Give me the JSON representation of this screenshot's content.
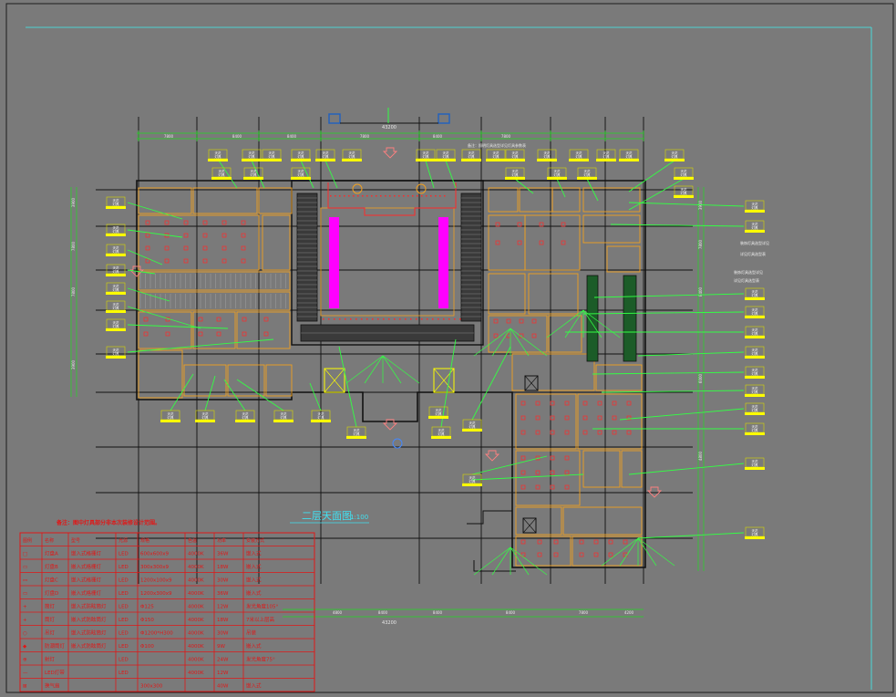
{
  "colors": {
    "background": "#7a7a7a",
    "frame": "#3ff0f0",
    "wall": "#111111",
    "partition": "#f0a020",
    "dimension": "#22dd22",
    "leader": "#33ff44",
    "tag_box": "#ffff00",
    "legend": "#e01818",
    "magenta": "#ff00ff",
    "stair": "#2a2a2a",
    "green_block": "#1c5c28",
    "light_red": "#ff2a2a",
    "cyan_text": "#40e0f0"
  },
  "plan": {
    "title": "二层天面图",
    "scale": "1:100",
    "overall_dim_top": "43200",
    "overall_dim_bottom": "43200",
    "note_top": "备注：照明灯具选型详见灯具参数表"
  },
  "legend": {
    "note": "备注：图中灯具部分非本次装修设计范围。",
    "headers": [
      "图例",
      "名称",
      "型号",
      "光源",
      "规格",
      "色温",
      "功率",
      "安装方式"
    ],
    "rows": [
      [
        "□",
        "灯盘A",
        "嵌入式格栅灯",
        "LED",
        "600x600x9",
        "4000K",
        "36W",
        "嵌入式"
      ],
      [
        "▭",
        "灯盘B",
        "嵌入式格栅灯",
        "LED",
        "300x300x9",
        "4000K",
        "18W",
        "嵌入式"
      ],
      [
        "▭",
        "灯盘C",
        "嵌入式格栅灯",
        "LED",
        "1200x100x9",
        "4000K",
        "30W",
        "嵌入式"
      ],
      [
        "▭",
        "灯盘D",
        "嵌入式格栅灯",
        "LED",
        "1200x300x9",
        "4000K",
        "36W",
        "嵌入式"
      ],
      [
        "+",
        "筒灯",
        "嵌入式防眩筒灯",
        "LED",
        "Φ125",
        "4000K",
        "12W",
        "发光角度105°"
      ],
      [
        "+",
        "筒灯",
        "嵌入式防眩筒灯",
        "LED",
        "Φ150",
        "4000K",
        "18W",
        "7米以上层高"
      ],
      [
        "○",
        "吊灯",
        "嵌入式防眩筒灯",
        "LED",
        "Φ1200*H300",
        "4000K",
        "30W",
        "吊装"
      ],
      [
        "◆",
        "防潮筒灯",
        "嵌入式防眩筒灯",
        "LED",
        "Φ100",
        "4000K",
        "9W",
        "嵌入式"
      ],
      [
        "⊕",
        "射灯",
        "",
        "LED",
        "",
        "4000K",
        "24W",
        "发光角度75°"
      ],
      [
        "—",
        "LED灯带",
        "",
        "LED",
        "",
        "4000K",
        "12W",
        ""
      ],
      [
        "⊠",
        "换气扇",
        "",
        "",
        "300x300",
        "",
        "40W",
        "嵌入式"
      ]
    ]
  },
  "tag": {
    "line1": "天花",
    "line2": "灯具"
  },
  "annotations": {
    "right_a": "装饰灯具选型详见",
    "right_b": "装饰灯具选型详见",
    "right_c": "详见灯具选型表",
    "right_d": "详见灯具选型表"
  },
  "dims_top": [
    "7800",
    "8400",
    "8400",
    "7800",
    "8400",
    "7800"
  ],
  "dims_left": [
    "3900",
    "7800",
    "7800",
    "3900"
  ],
  "dims_right": [
    "3900",
    "7800",
    "8400",
    "6000",
    "4800"
  ],
  "dims_bottom": [
    "4800",
    "8400",
    "8400",
    "8400",
    "7800",
    "4200"
  ]
}
